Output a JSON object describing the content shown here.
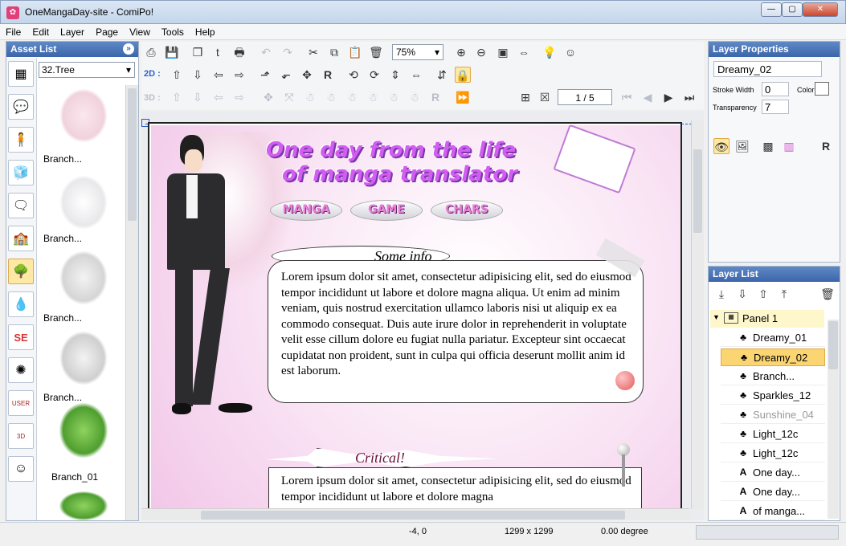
{
  "window": {
    "title": "OneMangaDay-site - ComiPo!",
    "minimize": "—",
    "maximize": "▢",
    "close": "✕"
  },
  "menu": [
    "File",
    "Edit",
    "Layer",
    "Page",
    "View",
    "Tools",
    "Help"
  ],
  "asset_list": {
    "header": "Asset List",
    "category_select": "32.Tree",
    "categories": [
      "panel-icon",
      "balloon-icon",
      "character-icon",
      "3d-object-icon",
      "speech-icon",
      "background-icon",
      "tree-icon",
      "drop-icon",
      "sound-effect-icon",
      "flash-icon",
      "user-icon",
      "user-3d-icon",
      "face-icon"
    ],
    "items": [
      {
        "label": "Branch..."
      },
      {
        "label": "Branch..."
      },
      {
        "label": "Branch..."
      },
      {
        "label": "Branch..."
      },
      {
        "label": "Branch_01"
      }
    ]
  },
  "toolbar": {
    "zoom": "75%",
    "mode_2d": "2D :",
    "mode_3d": "3D :",
    "page_indicator": "1 / 5"
  },
  "comic": {
    "title_line1": "One day from the life",
    "title_line2": "of manga translator",
    "nav": [
      "MANGA",
      "GAME",
      "CHARS"
    ],
    "box1_heading": "Some info",
    "box1_text": "Lorem ipsum dolor sit amet, consectetur adipisicing elit, sed do eiusmod tempor incididunt ut labore et dolore magna aliqua. Ut enim ad minim veniam, quis nostrud exercitation ullamco laboris nisi ut aliquip ex ea commodo consequat. Duis aute irure dolor in reprehenderit in voluptate velit esse cillum dolore eu fugiat nulla pariatur. Excepteur sint occaecat cupidatat non proident, sunt in culpa qui officia deserunt mollit anim id est laborum.",
    "box2_heading": "Critical!",
    "box2_text": "Lorem ipsum dolor sit amet, consectetur adipisicing elit, sed do eiusmod tempor incididunt ut labore et dolore magna"
  },
  "layer_properties": {
    "header": "Layer Properties",
    "name": "Dreamy_02",
    "stroke_width_label": "Stroke Width",
    "stroke_width": "0",
    "color_label": "Color",
    "transparency_label": "Transparency",
    "transparency": "7"
  },
  "layer_list": {
    "header": "Layer List",
    "group": "Panel 1",
    "layers": [
      {
        "name": "Dreamy_01",
        "icon": "tree-icon"
      },
      {
        "name": "Dreamy_02",
        "icon": "tree-icon",
        "selected": true
      },
      {
        "name": "Branch...",
        "icon": "tree-icon"
      },
      {
        "name": "Sparkles_12",
        "icon": "tree-icon"
      },
      {
        "name": "Sunshine_04",
        "icon": "tree-icon",
        "dim": true
      },
      {
        "name": "Light_12c",
        "icon": "tree-icon"
      },
      {
        "name": "Light_12c",
        "icon": "tree-icon"
      },
      {
        "name": "One day...",
        "icon": "text-icon"
      },
      {
        "name": "One day...",
        "icon": "text-icon"
      },
      {
        "name": "of manga...",
        "icon": "text-icon"
      }
    ]
  },
  "status": {
    "coords": "-4, 0",
    "size": "1299 x 1299",
    "angle": "0.00 degree"
  }
}
